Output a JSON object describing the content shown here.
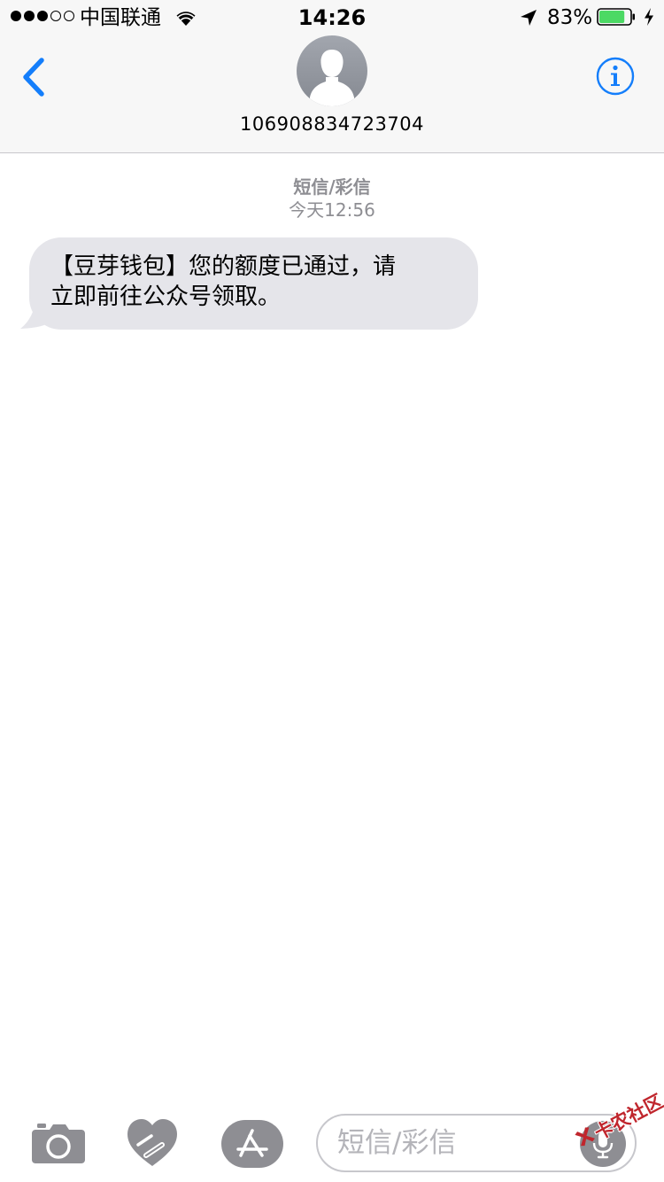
{
  "status_bar": {
    "signal_dots_filled": 3,
    "signal_dots_empty": 2,
    "carrier": "中国联通",
    "time": "14:26",
    "battery_percent": "83%",
    "battery_level": 0.83,
    "battery_color": "#4cd964",
    "icons": [
      "wifi-icon",
      "location-arrow-icon",
      "battery-icon",
      "charging-bolt-icon"
    ]
  },
  "header": {
    "contact": "106908834723704",
    "back_icon": "chevron-left-icon",
    "info_icon": "info-circle-icon",
    "accent_color": "#147efb"
  },
  "conversation": {
    "message_type": "短信/彩信",
    "timestamp": "今天12:56",
    "messages": [
      {
        "direction": "received",
        "lines": [
          "【豆芽钱包】您的额度已通过，请",
          "立即前往公众号领取。"
        ]
      }
    ]
  },
  "toolbar": {
    "compose_placeholder": "短信/彩信",
    "icons": [
      "camera-icon",
      "digital-touch-heart-icon",
      "app-store-icon",
      "microphone-icon"
    ]
  },
  "watermark": {
    "text": "卡农社区"
  }
}
